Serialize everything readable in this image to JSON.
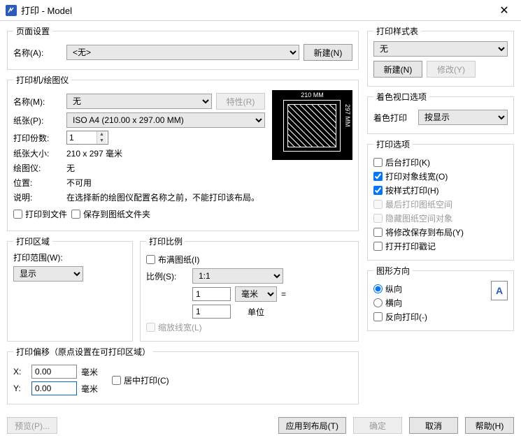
{
  "window": {
    "title": "打印 - Model"
  },
  "page_setup": {
    "legend": "页面设置",
    "name_label": "名称(A):",
    "name_value": "<无>",
    "new_btn": "新建(N)"
  },
  "printer": {
    "legend": "打印机/绘图仪",
    "name_label": "名称(M):",
    "name_value": "无",
    "props_btn": "特性(R)",
    "paper_label": "纸张(P):",
    "paper_value": "ISO A4 (210.00 x 297.00 MM)",
    "copies_label": "打印份数:",
    "copies_value": "1",
    "size_label": "纸张大小:",
    "size_value": "210 x 297  毫米",
    "plotter_label": "绘图仪:",
    "plotter_value": "无",
    "loc_label": "位置:",
    "loc_value": "不可用",
    "desc_label": "说明:",
    "desc_value": "在选择新的绘图仪配置名称之前，不能打印该布局。",
    "to_file": "打印到文件",
    "save_paper": "保存到图纸文件夹",
    "preview_w": "210 MM",
    "preview_h": "297 MM"
  },
  "area": {
    "legend": "打印区域",
    "scope_label": "打印范围(W):",
    "scope_value": "显示"
  },
  "scale": {
    "legend": "打印比例",
    "fit": "布满图纸(I)",
    "ratio_label": "比例(S):",
    "ratio_value": "1:1",
    "num": "1",
    "unit_sel": "毫米",
    "eq": "=",
    "den": "1",
    "unit_lbl": "单位",
    "lw": "缩放线宽(L)"
  },
  "offset": {
    "legend": "打印偏移（原点设置在可打印区域）",
    "x_lbl": "X:",
    "x_val": "0.00",
    "x_unit": "毫米",
    "y_lbl": "Y:",
    "y_val": "0.00",
    "y_unit": "毫米",
    "center": "居中打印(C)"
  },
  "style": {
    "legend": "打印样式表",
    "value": "无",
    "new_btn": "新建(N)",
    "mod_btn": "修改(Y)"
  },
  "viewport": {
    "legend": "着色视口选项",
    "shade_label": "着色打印",
    "shade_value": "按显示"
  },
  "options": {
    "legend": "打印选项",
    "bg": "后台打印(K)",
    "lw": "打印对象线宽(O)",
    "bystyle": "按样式打印(H)",
    "paperspace_last": "最后打印图纸空间",
    "hide_paperspace": "隐藏图纸空间对象",
    "save_layout": "将修改保存到布局(Y)",
    "stamp": "打开打印戳记"
  },
  "orient": {
    "legend": "图形方向",
    "portrait": "纵向",
    "landscape": "横向",
    "upside": "反向打印(-)",
    "glyph": "A"
  },
  "footer": {
    "preview": "预览(P)...",
    "apply": "应用到布局(T)",
    "ok": "确定",
    "cancel": "取消",
    "help": "帮助(H)"
  }
}
